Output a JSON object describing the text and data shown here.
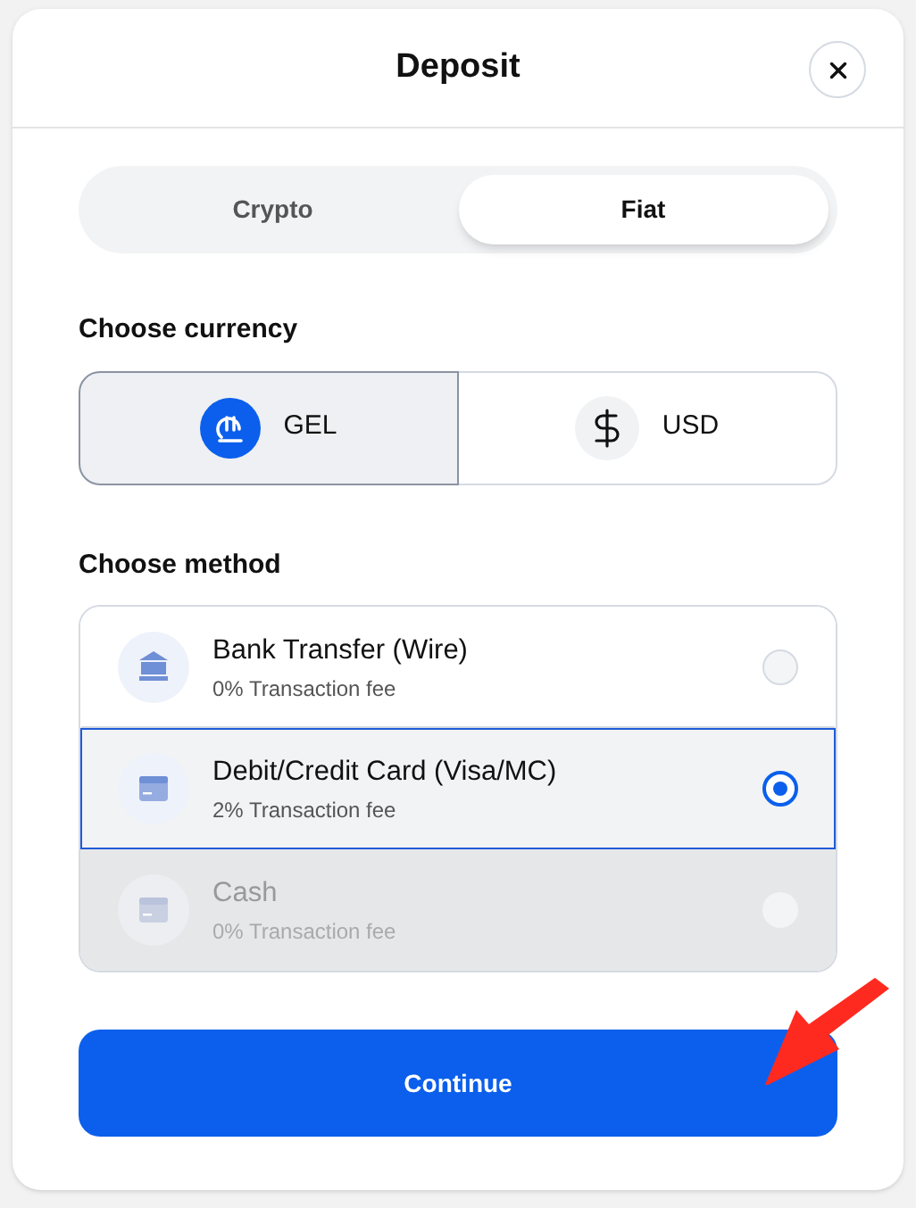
{
  "dialog": {
    "title": "Deposit"
  },
  "tabs": [
    {
      "label": "Crypto",
      "selected": false
    },
    {
      "label": "Fiat",
      "selected": true
    }
  ],
  "currency": {
    "heading": "Choose currency",
    "options": [
      {
        "code": "GEL",
        "kind": "lari",
        "selected": true
      },
      {
        "code": "USD",
        "kind": "dollar",
        "selected": false
      }
    ]
  },
  "method": {
    "heading": "Choose method",
    "options": [
      {
        "name": "Bank Transfer (Wire)",
        "fee": "0% Transaction fee",
        "kind": "bank",
        "selected": false,
        "disabled": false
      },
      {
        "name": "Debit/Credit Card (Visa/MC)",
        "fee": "2% Transaction fee",
        "kind": "card",
        "selected": true,
        "disabled": false
      },
      {
        "name": "Cash",
        "fee": "0% Transaction fee",
        "kind": "card",
        "selected": false,
        "disabled": true
      }
    ]
  },
  "continue_button": "Continue"
}
